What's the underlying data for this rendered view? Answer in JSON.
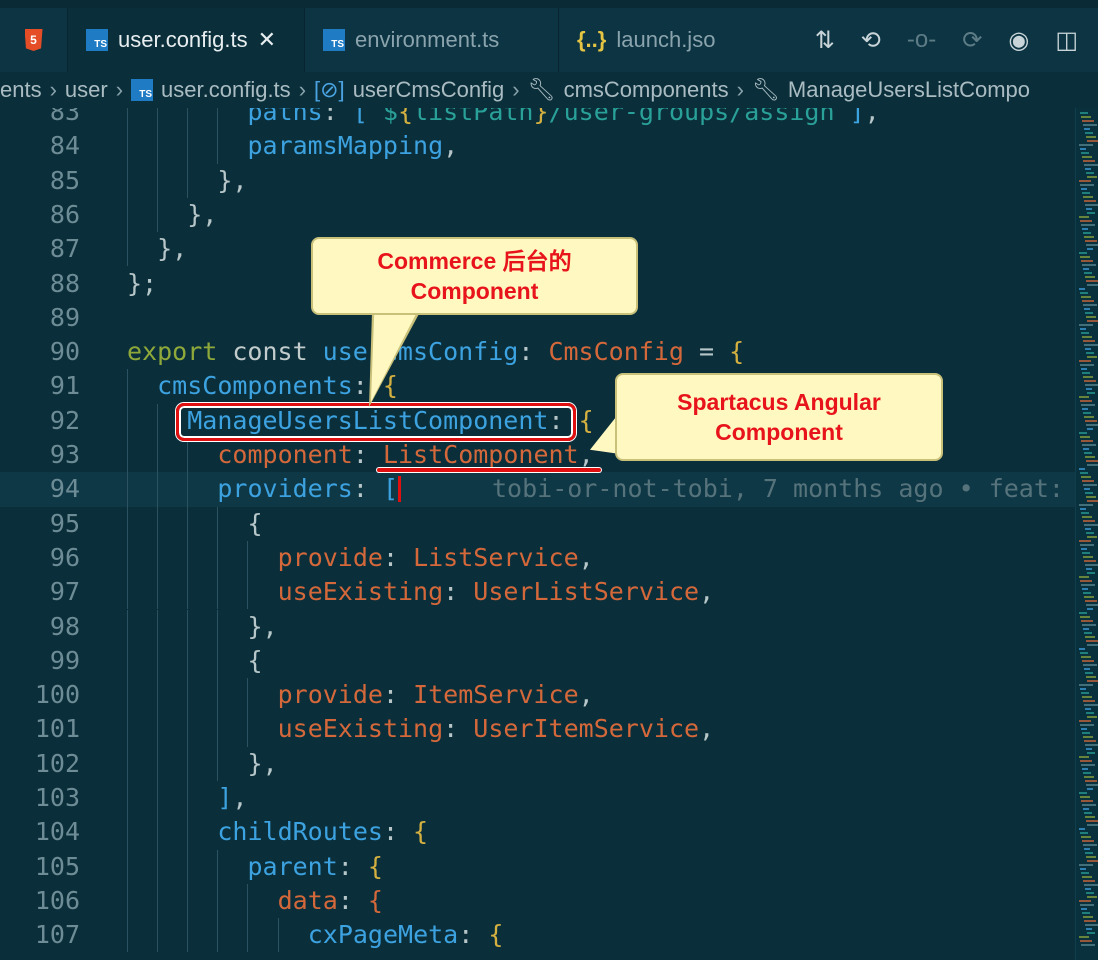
{
  "tabs": [
    {
      "label": "",
      "icon": "html5-icon"
    },
    {
      "label": "user.config.ts",
      "icon": "typescript-icon",
      "active": true,
      "close": "✕"
    },
    {
      "label": "environment.ts",
      "icon": "typescript-icon"
    },
    {
      "label": "launch.jso",
      "icon": "json-icon",
      "icon_text": "{..}"
    }
  ],
  "breadcrumb": [
    "ents",
    "user",
    "user.config.ts",
    "userCmsConfig",
    "cmsComponents",
    "ManageUsersListCompo"
  ],
  "blame": "tobi-or-not-tobi, 7 months ago • feat:",
  "lines": [
    {
      "n": "83",
      "i": 4,
      "t": [
        [
          "prop",
          "paths"
        ],
        [
          "pu",
          ": "
        ],
        [
          "prop",
          "["
        ],
        [
          "str",
          "`$"
        ],
        [
          "tm",
          "{"
        ],
        [
          "str",
          "listPath"
        ],
        [
          "tm",
          "}"
        ],
        [
          "str",
          "/user-groups/assign`"
        ],
        [
          "prop",
          "]"
        ],
        [
          "pu",
          ","
        ]
      ]
    },
    {
      "n": "84",
      "i": 4,
      "t": [
        [
          "prop",
          "paramsMapping"
        ],
        [
          "pu",
          ","
        ]
      ]
    },
    {
      "n": "85",
      "i": 3,
      "t": [
        [
          "pu",
          "},"
        ]
      ]
    },
    {
      "n": "86",
      "i": 2,
      "t": [
        [
          "pu",
          "},"
        ]
      ]
    },
    {
      "n": "87",
      "i": 1,
      "t": [
        [
          "pu",
          "},"
        ]
      ]
    },
    {
      "n": "88",
      "i": 0,
      "t": [
        [
          "pu",
          "};"
        ]
      ]
    },
    {
      "n": "89",
      "i": 0,
      "t": []
    },
    {
      "n": "90",
      "i": 0,
      "t": [
        [
          "kw",
          "export"
        ],
        [
          "k2",
          " const "
        ],
        [
          "prop",
          "userCmsConfig"
        ],
        [
          "pu",
          ": "
        ],
        [
          "type",
          "CmsConfig"
        ],
        [
          "pu",
          " = "
        ],
        [
          "br",
          "{"
        ]
      ]
    },
    {
      "n": "91",
      "i": 1,
      "t": [
        [
          "prop",
          "cmsComponents"
        ],
        [
          "pu",
          ": "
        ],
        [
          "br",
          "{"
        ]
      ]
    },
    {
      "n": "92",
      "i": 2,
      "t": [
        [
          "prop",
          "ManageUsersListComponent"
        ],
        [
          "pu",
          ": "
        ],
        [
          "br",
          "{"
        ]
      ]
    },
    {
      "n": "93",
      "i": 3,
      "t": [
        [
          "org",
          "component"
        ],
        [
          "pu",
          ": "
        ],
        [
          "type",
          "ListComponent"
        ],
        [
          "pu",
          ","
        ]
      ]
    },
    {
      "n": "94",
      "i": 3,
      "t": [
        [
          "prop",
          "providers"
        ],
        [
          "pu",
          ": "
        ],
        [
          "prop",
          "["
        ]
      ],
      "cur": true
    },
    {
      "n": "95",
      "i": 4,
      "t": [
        [
          "pu",
          "{"
        ]
      ]
    },
    {
      "n": "96",
      "i": 5,
      "t": [
        [
          "org",
          "provide"
        ],
        [
          "pu",
          ": "
        ],
        [
          "type",
          "ListService"
        ],
        [
          "pu",
          ","
        ]
      ]
    },
    {
      "n": "97",
      "i": 5,
      "t": [
        [
          "org",
          "useExisting"
        ],
        [
          "pu",
          ": "
        ],
        [
          "type",
          "UserListService"
        ],
        [
          "pu",
          ","
        ]
      ]
    },
    {
      "n": "98",
      "i": 4,
      "t": [
        [
          "pu",
          "},"
        ]
      ]
    },
    {
      "n": "99",
      "i": 4,
      "t": [
        [
          "pu",
          "{"
        ]
      ]
    },
    {
      "n": "100",
      "i": 5,
      "t": [
        [
          "org",
          "provide"
        ],
        [
          "pu",
          ": "
        ],
        [
          "type",
          "ItemService"
        ],
        [
          "pu",
          ","
        ]
      ]
    },
    {
      "n": "101",
      "i": 5,
      "t": [
        [
          "org",
          "useExisting"
        ],
        [
          "pu",
          ": "
        ],
        [
          "type",
          "UserItemService"
        ],
        [
          "pu",
          ","
        ]
      ]
    },
    {
      "n": "102",
      "i": 4,
      "t": [
        [
          "pu",
          "},"
        ]
      ]
    },
    {
      "n": "103",
      "i": 3,
      "t": [
        [
          "prop",
          "]"
        ],
        [
          "pu",
          ","
        ]
      ]
    },
    {
      "n": "104",
      "i": 3,
      "t": [
        [
          "prop",
          "childRoutes"
        ],
        [
          "pu",
          ": "
        ],
        [
          "br",
          "{"
        ]
      ]
    },
    {
      "n": "105",
      "i": 4,
      "t": [
        [
          "prop",
          "parent"
        ],
        [
          "pu",
          ": "
        ],
        [
          "br",
          "{"
        ]
      ]
    },
    {
      "n": "106",
      "i": 5,
      "t": [
        [
          "org",
          "data"
        ],
        [
          "pu",
          ": "
        ],
        [
          "org",
          "{"
        ]
      ]
    },
    {
      "n": "107",
      "i": 6,
      "t": [
        [
          "prop",
          "cxPageMeta"
        ],
        [
          "pu",
          ": "
        ],
        [
          "br",
          "{"
        ]
      ]
    }
  ],
  "callouts": {
    "commerce": [
      "Commerce 后台的",
      "Component"
    ],
    "spartacus": [
      "Spartacus Angular",
      "Component"
    ]
  }
}
